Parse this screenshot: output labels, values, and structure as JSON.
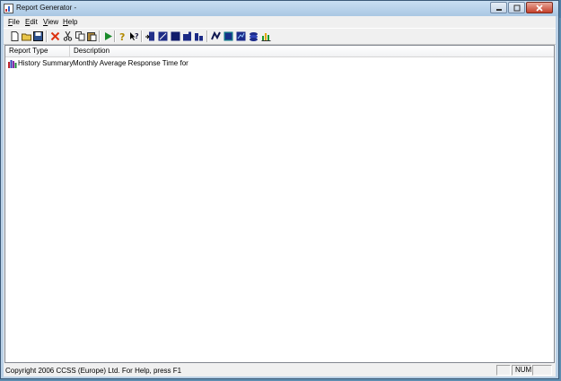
{
  "window": {
    "title": "Report Generator -"
  },
  "menu": [
    {
      "label": "File",
      "underline": "F",
      "rest": "ile"
    },
    {
      "label": "Edit",
      "underline": "E",
      "rest": "dit"
    },
    {
      "label": "View",
      "underline": "V",
      "rest": "iew"
    },
    {
      "label": "Help",
      "underline": "H",
      "rest": "elp"
    }
  ],
  "toolbar": {
    "icons": [
      "new-icon",
      "open-icon",
      "save-icon",
      "delete-icon",
      "cut-icon",
      "copy-icon",
      "paste-icon",
      "run-icon",
      "help-icon",
      "context-help-icon",
      "report1-icon",
      "report2-icon",
      "report3-icon",
      "report4-icon",
      "report5-icon",
      "report6-icon",
      "report7-icon",
      "report8-icon",
      "report9-icon",
      "chart-icon"
    ]
  },
  "list": {
    "columns": [
      "Report Type",
      "Description"
    ],
    "rows": [
      {
        "type": "History Summary",
        "description": "Monthly Average Response Time for"
      }
    ]
  },
  "status": {
    "text": "Copyright 2006 CCSS (Europe) Ltd. For Help, press F1",
    "num": "NUM"
  },
  "colors": {
    "accent": "#2a5fa8",
    "window_frame": "#b9d0e6",
    "close": "#c5402a"
  }
}
